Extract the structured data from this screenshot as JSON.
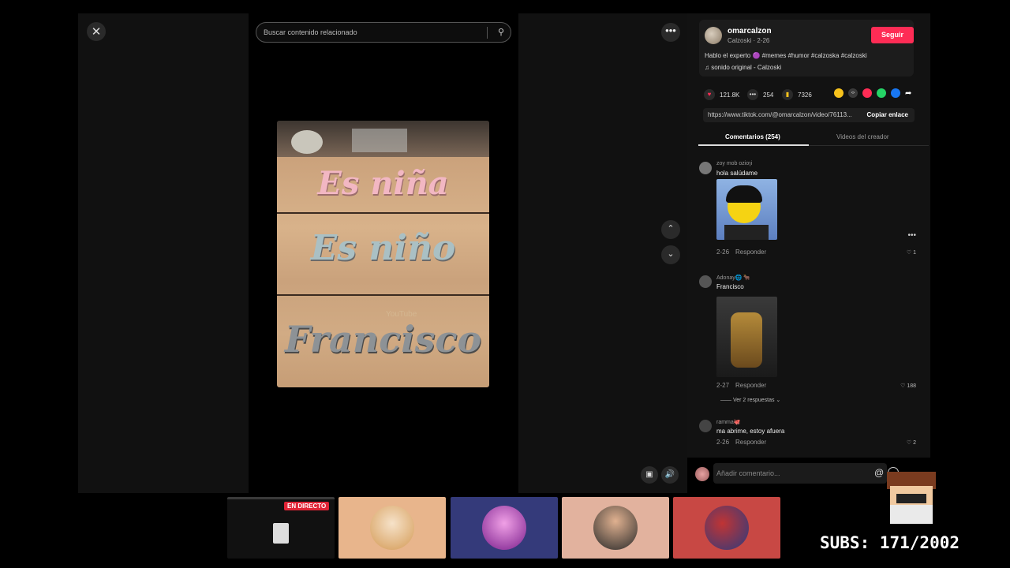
{
  "search": {
    "placeholder": "Buscar contenido relacionado"
  },
  "video": {
    "overlay_lines": [
      "Es niña",
      "Es niño",
      "Francisco"
    ],
    "watermark": "YouTube"
  },
  "creator": {
    "username": "omarcalzon",
    "subline": "Calzoski · 2-26",
    "follow_label": "Seguir",
    "caption": "Hablo el experto 🟣 #memes #humor #calzoska #calzoski",
    "sound": "♫  sonido original - Calzoski"
  },
  "stats": {
    "likes": "121.8K",
    "comments": "254",
    "saves": "7326"
  },
  "share_link": {
    "url": "https://www.tiktok.com/@omarcalzon/video/76113...",
    "copy_label": "Copiar enlace"
  },
  "tabs": [
    {
      "label": "Comentarios (254)"
    },
    {
      "label": "Videos del creador"
    }
  ],
  "comments": [
    {
      "user": "zoy mob ozioɿi",
      "text": "hola salúdame",
      "date": "2-26",
      "reply": "Responder",
      "likes": "1"
    },
    {
      "user": "Adonay🌐 🐂",
      "text": "Francisco",
      "date": "2-27",
      "reply": "Responder",
      "likes": "188",
      "view_replies": "Ver 2 respuestas ⌄"
    },
    {
      "user": "ramma🐙",
      "text": "ma abrime, estoy afuera",
      "date": "2-26",
      "reply": "Responder",
      "likes": "2"
    }
  ],
  "comment_input": {
    "placeholder": "Añadir comentario..."
  },
  "stream": {
    "live_label": "EN DIRECTO",
    "subs": "SUBS: 171/2002"
  },
  "colors": {
    "accent": "#fe2c55",
    "live": "#e02436"
  }
}
